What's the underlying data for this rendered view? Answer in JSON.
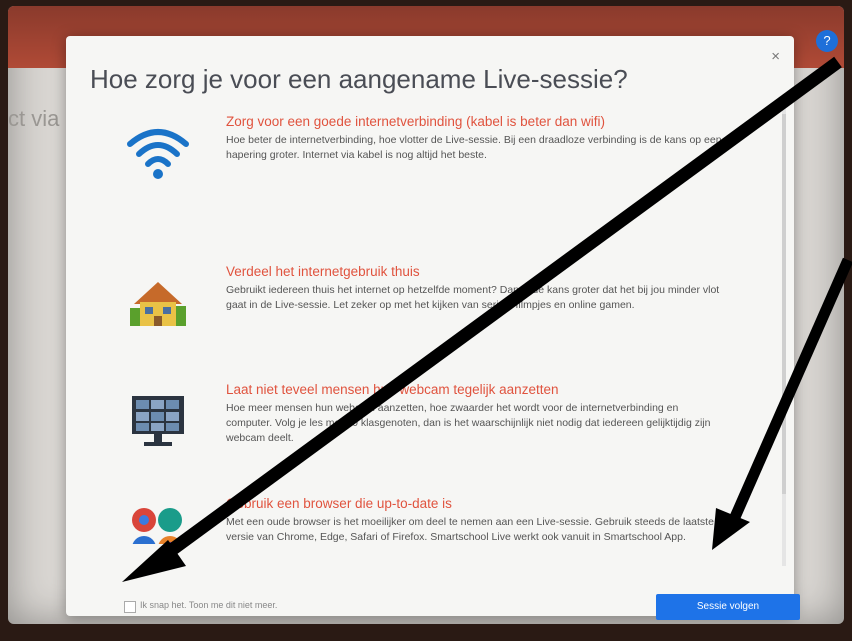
{
  "background": {
    "partial_text": "ct via '",
    "badge": "?"
  },
  "dialog": {
    "title": "Hoe zorg je voor een aangename Live-sessie?",
    "close": "×",
    "tips": [
      {
        "icon": "wifi-icon",
        "heading": "Zorg voor een goede internetverbinding (kabel is beter dan wifi)",
        "body": "Hoe beter de internetverbinding, hoe vlotter de Live-sessie. Bij een draadloze verbinding is de kans op een hapering groter. Internet via kabel is nog altijd het beste."
      },
      {
        "icon": "house-icon",
        "heading": "Verdeel het internetgebruik thuis",
        "body": "Gebruikt iedereen thuis het internet op hetzelfde moment? Dan is de kans groter dat het bij jou minder vlot gaat in de Live-sessie. Let zeker op met het kijken van series, filmpjes en online gamen."
      },
      {
        "icon": "webcam-grid-icon",
        "heading": "Laat niet teveel mensen hun webcam tegelijk aanzetten",
        "body": "Hoe meer mensen hun webcam aanzetten, hoe zwaarder het wordt voor de internetverbinding en computer. Volg je les met 20 klasgenoten, dan is het waarschijnlijk niet nodig dat iedereen gelijktijdig zijn webcam deelt."
      },
      {
        "icon": "browsers-icon",
        "heading": "Gebruik een browser die up-to-date is",
        "body": "Met een oude browser is het moeilijker om deel te nemen aan een Live-sessie. Gebruik steeds de laatste versie van Chrome, Edge, Safari of Firefox. Smartschool Live werkt ook vanuit in Smartschool App."
      }
    ],
    "checkbox_label": "Ik snap het. Toon me dit niet meer.",
    "next_button": "Sessie volgen"
  },
  "colors": {
    "heading": "#e0533e",
    "button": "#1e73e8",
    "topbar": "#b04a36"
  }
}
